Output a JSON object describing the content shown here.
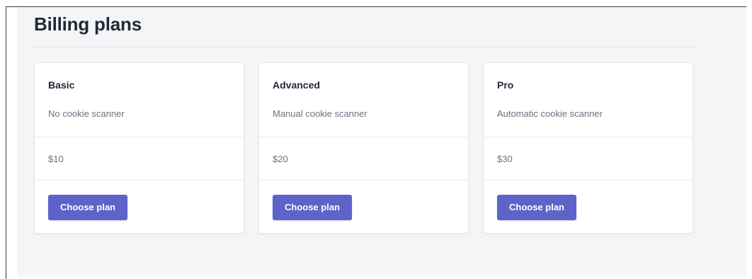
{
  "page": {
    "title": "Billing plans"
  },
  "plans": [
    {
      "name": "Basic",
      "description": "No cookie scanner",
      "price": "$10",
      "button_label": "Choose plan"
    },
    {
      "name": "Advanced",
      "description": "Manual cookie scanner",
      "price": "$20",
      "button_label": "Choose plan"
    },
    {
      "name": "Pro",
      "description": "Automatic cookie scanner",
      "price": "$30",
      "button_label": "Choose plan"
    }
  ],
  "colors": {
    "accent": "#5d63c8",
    "background": "#f4f5f7",
    "heading": "#1f2937",
    "muted": "#6b7280"
  }
}
